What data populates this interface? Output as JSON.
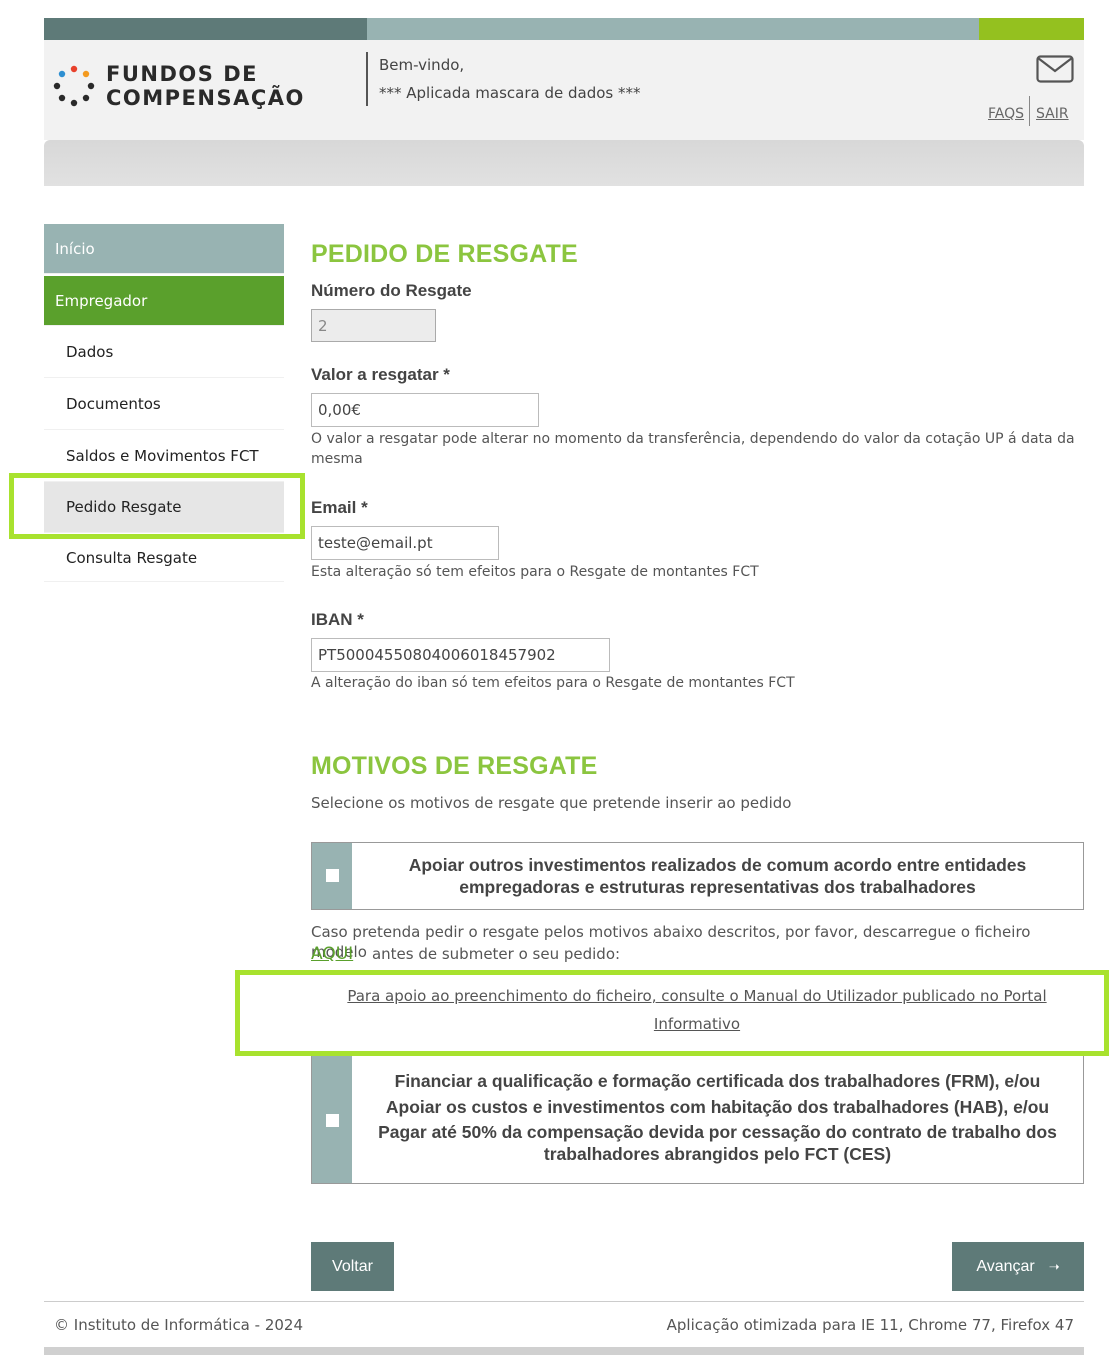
{
  "header": {
    "logo_line1": "FUNDOS DE",
    "logo_line2": "COMPENSAÇÃO",
    "welcome": "Bem-vindo,",
    "user_masked": "*** Aplicada mascara de dados ***",
    "faqs_label": "FAQS",
    "sair_label": "SAIR",
    "mail_icon": "envelope-icon"
  },
  "sidebar": {
    "items": [
      {
        "label": "Início"
      },
      {
        "label": "Empregador"
      },
      {
        "label": "Dados"
      },
      {
        "label": "Documentos"
      },
      {
        "label": "Saldos e Movimentos FCT"
      },
      {
        "label": "Pedido Resgate"
      },
      {
        "label": "Consulta Resgate"
      }
    ]
  },
  "pedido": {
    "title": "PEDIDO DE RESGATE",
    "numero_label": "Número do Resgate",
    "numero_value": "2",
    "valor_label": "Valor a resgatar  *",
    "valor_value": "0,00€",
    "valor_help": "O valor a resgatar pode alterar no momento da transferência, dependendo do valor da cotação UP á data da mesma",
    "email_label": "Email  *",
    "email_value": "teste@email.pt",
    "email_help": "Esta alteração só tem efeitos para o Resgate de montantes FCT",
    "iban_label": "IBAN  *",
    "iban_value": "PT50004550804006018457902",
    "iban_help": "A alteração do iban só tem efeitos para o Resgate de montantes FCT"
  },
  "motivos": {
    "title": "MOTIVOS DE RESGATE",
    "intro": "Selecione os motivos de resgate que pretende inserir ao pedido",
    "option1_line1": "Apoiar outros investimentos realizados de comum acordo entre entidades",
    "option1_line2": "empregadoras e estruturas representativas dos trabalhadores",
    "download_text_1": "Caso pretenda pedir o resgate pelos motivos abaixo descritos, por favor, descarregue o ficheiro modelo",
    "aqui_label": "AQUI",
    "download_text_2": "antes de submeter o seu pedido:",
    "manual_link": "Para apoio ao preenchimento do ficheiro, consulte o Manual do Utilizador publicado no Portal Informativo",
    "option2_line1": "Financiar a qualificação e formação certificada dos trabalhadores (FRM), e/ou",
    "option2_line2": "Apoiar os custos e investimentos com habitação dos trabalhadores (HAB), e/ou",
    "option2_line3": "Pagar até 50% da compensação devida por cessação do contrato de trabalho dos",
    "option2_line4": "trabalhadores abrangidos pelo FCT (CES)"
  },
  "actions": {
    "voltar_label": "Voltar",
    "avancar_label": "Avançar",
    "avancar_arrow": "➝"
  },
  "footer": {
    "copyright": "© Instituto de Informática - 2024",
    "browsers": "Aplicação otimizada para IE 11, Chrome 77, Firefox 47"
  },
  "colors": {
    "accent_green": "#8bc53f",
    "nav_green": "#5aa02c",
    "teal": "#5e7a78",
    "highlight": "#a8e22e"
  }
}
